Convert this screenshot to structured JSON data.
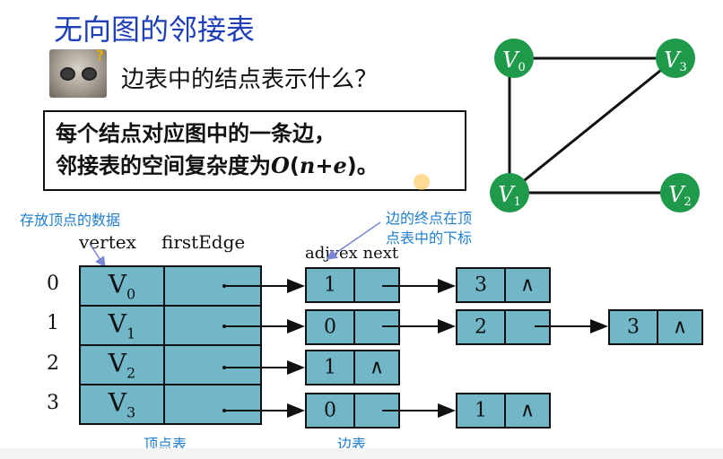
{
  "title": "无向图的邻接表",
  "question": "边表中的结点表示什么？",
  "answer": {
    "line1": "每个结点对应图中的一条边，",
    "line2_prefix": "邻接表的空间复杂度为",
    "formula_O": "O",
    "formula_open": "(",
    "formula_n": "n",
    "formula_plus": "+",
    "formula_e": "e",
    "formula_close": ")",
    "line2_suffix": "。"
  },
  "notes": {
    "vertex_data": "存放顶点的数据",
    "adjvex_line1": "边的终点在顶",
    "adjvex_line2": "点表中的下标"
  },
  "headers": {
    "vertex": "vertex",
    "firstEdge": "firstEdge",
    "adjvex_next": "adjvex next"
  },
  "vertex_table": {
    "label": "顶点表",
    "rows": [
      {
        "index": "0",
        "name": "V",
        "sub": "0"
      },
      {
        "index": "1",
        "name": "V",
        "sub": "1"
      },
      {
        "index": "2",
        "name": "V",
        "sub": "2"
      },
      {
        "index": "3",
        "name": "V",
        "sub": "3"
      }
    ]
  },
  "edge_table": {
    "label": "边表",
    "null_symbol": "∧",
    "rows": [
      {
        "vertex": 0,
        "chain": [
          "1",
          "3"
        ]
      },
      {
        "vertex": 1,
        "chain": [
          "0",
          "2",
          "3"
        ]
      },
      {
        "vertex": 2,
        "chain": [
          "1"
        ]
      },
      {
        "vertex": 3,
        "chain": [
          "0",
          "1"
        ]
      }
    ]
  },
  "graph": {
    "node_color": "#1f9a4a",
    "nodes": [
      {
        "id": "V0",
        "letter": "V",
        "sub": "0"
      },
      {
        "id": "V3",
        "letter": "V",
        "sub": "3"
      },
      {
        "id": "V1",
        "letter": "V",
        "sub": "1"
      },
      {
        "id": "V2",
        "letter": "V",
        "sub": "2"
      }
    ],
    "edges": [
      [
        "V0",
        "V3"
      ],
      [
        "V0",
        "V1"
      ],
      [
        "V1",
        "V3"
      ],
      [
        "V1",
        "V2"
      ]
    ]
  },
  "colors": {
    "title": "#1f3fb8",
    "note": "#1f7ed0",
    "cell_fill": "#72b7c8"
  }
}
